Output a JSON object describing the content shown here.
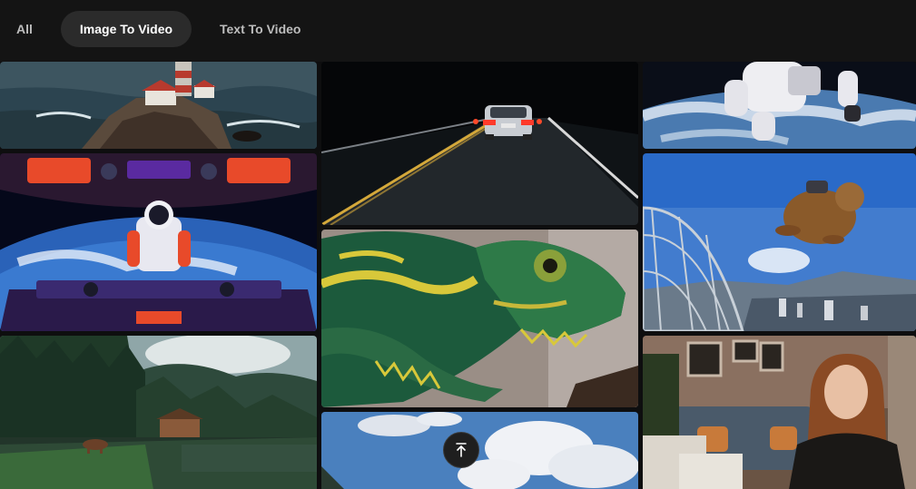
{
  "tabs": [
    {
      "label": "All",
      "active": false
    },
    {
      "label": "Image To Video",
      "active": true
    },
    {
      "label": "Text To Video",
      "active": false
    }
  ],
  "colors": {
    "background": "#0e0e0f",
    "topbar": "#141414",
    "active_tab_bg": "#2b2b2b",
    "tab_text": "#bdbdbd",
    "active_tab_text": "#ffffff"
  },
  "gallery": {
    "tiles": [
      {
        "subject": "lighthouse on rocky coast"
      },
      {
        "subject": "astronaut DJ in spaceship above Earth"
      },
      {
        "subject": "forest lake cabin with deer"
      },
      {
        "subject": "car driving on night road"
      },
      {
        "subject": "green chameleon close-up"
      },
      {
        "subject": "sky with clouds"
      },
      {
        "subject": "astronaut floating above Earth"
      },
      {
        "subject": "flying marmot with jetpack over city"
      },
      {
        "subject": "woman in living room with laptop"
      }
    ]
  },
  "scroll_top": {
    "icon": "arrow-up-to-line-icon"
  }
}
